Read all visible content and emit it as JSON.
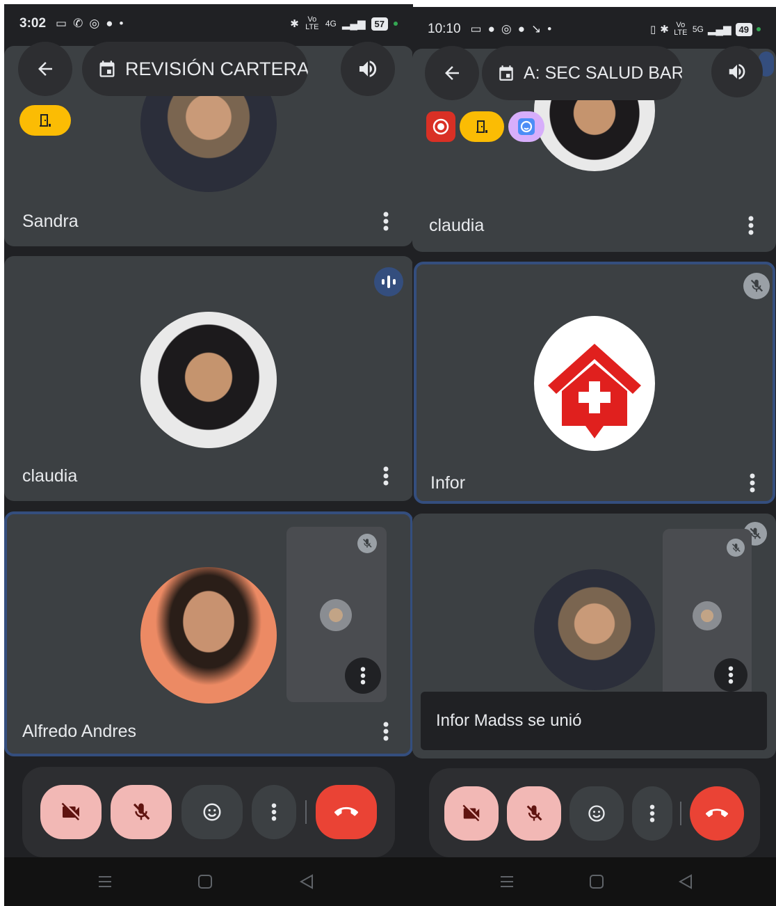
{
  "left": {
    "status": {
      "time": "3:02",
      "data_icon": "Vo LTE",
      "network": "4G",
      "battery": "57"
    },
    "header": {
      "meeting_title": "REVISIÓN CARTERA"
    },
    "tiles": [
      {
        "name": "Sandra"
      },
      {
        "name": "claudia"
      },
      {
        "name": "Alfredo Andres"
      }
    ]
  },
  "right": {
    "status": {
      "time": "10:10",
      "data_icon": "Vo LTE",
      "network": "5G",
      "battery": "49"
    },
    "header": {
      "meeting_title": "A: SEC SALUD BARR"
    },
    "tiles": [
      {
        "name": "claudia"
      },
      {
        "name": "Infor"
      },
      {
        "name": ""
      }
    ],
    "toast": "Infor Madss se unió"
  },
  "icons": {
    "back": "arrow-left-icon",
    "calendar": "calendar-icon",
    "speaker": "volume-icon",
    "camera_off": "video-off-icon",
    "mic_off": "mic-off-icon",
    "reactions": "emoji-icon",
    "more": "more-vertical-icon",
    "hangup": "call-end-icon",
    "speaking": "audio-level-icon",
    "host_controls": "door-icon",
    "recording": "record-icon",
    "transcript": "caption-icon"
  },
  "colors": {
    "background": "#202124",
    "tile": "#3c4043",
    "active_border": "#344e7e",
    "toggle_off": "#f2b8b5",
    "hangup": "#ea4335",
    "chip_yellow": "#fbbc04",
    "chip_record": "#d93025",
    "chip_transcript": "#d7aefb"
  }
}
